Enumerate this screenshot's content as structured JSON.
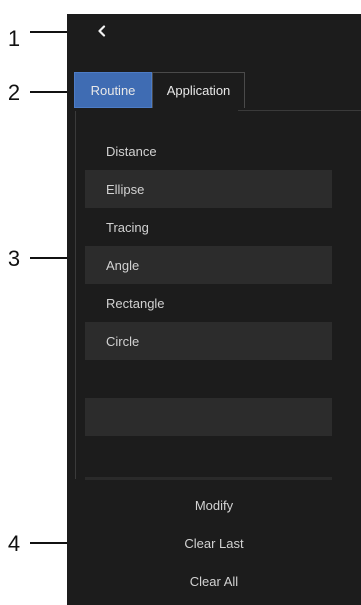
{
  "callouts": [
    "1",
    "2",
    "3",
    "4"
  ],
  "tabs": [
    {
      "label": "Routine",
      "active": true
    },
    {
      "label": "Application",
      "active": false
    }
  ],
  "measure_items": [
    {
      "label": "Distance"
    },
    {
      "label": "Ellipse"
    },
    {
      "label": "Tracing"
    },
    {
      "label": "Angle"
    },
    {
      "label": "Rectangle"
    },
    {
      "label": "Circle"
    }
  ],
  "actions": {
    "modify": "Modify",
    "clear_last": "Clear Last",
    "clear_all": "Clear All"
  },
  "icons": {
    "back": "chevron-left-icon"
  },
  "colors": {
    "panel_bg": "#1c1c1c",
    "active_tab": "#3f6cb3",
    "row_shade": "#2c2c2c",
    "text": "#d2d2d2"
  }
}
